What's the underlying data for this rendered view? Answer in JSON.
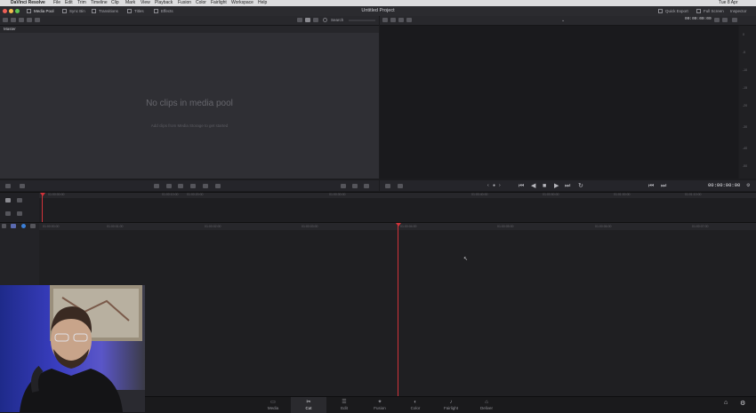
{
  "menubar": {
    "app": "DaVinci Resolve",
    "items": [
      "File",
      "Edit",
      "Trim",
      "Timeline",
      "Clip",
      "Mark",
      "View",
      "Playback",
      "Fusion",
      "Color",
      "Fairlight",
      "Workspace",
      "Help"
    ],
    "clock": "Tue 8 Apr"
  },
  "toolbar": {
    "media_pool": "Media Pool",
    "sync_bin": "Sync Bin",
    "transitions": "Transitions",
    "titles": "Titles",
    "effects": "Effects",
    "project_title": "Untitled Project",
    "quick_export": "Quick Export",
    "full_screen": "Full Screen",
    "inspector": "Inspector"
  },
  "media_pool": {
    "search_label": "Search",
    "bin_name": "Master",
    "empty_title": "No clips in media pool",
    "empty_subtitle": "Add clips from Media Storage to get started"
  },
  "viewer": {
    "timecode_top": "00:00:00:00",
    "timecode": "00:00:00:00",
    "meter_ticks": [
      "0",
      "-5",
      "-10",
      "-15",
      "-20",
      "-30",
      "-40",
      "-50"
    ]
  },
  "upper_timeline": {
    "ruler": [
      "01:00:00:00",
      "01:00:10:00",
      "01:00:20:00",
      "01:00:30:00",
      "01:00:40:00",
      "01:00:50:00",
      "01:01:00:00",
      "01:01:10:00"
    ]
  },
  "lower_timeline": {
    "ruler": [
      "01:00:00:00",
      "01:00:01:00",
      "01:00:02:00",
      "01:00:03:00",
      "01:00:04:00",
      "01:00:05:00",
      "01:00:06:00",
      "01:00:07:00"
    ]
  },
  "pages": [
    {
      "label": "Media",
      "icon": "media-page-icon"
    },
    {
      "label": "Cut",
      "icon": "cut-page-icon"
    },
    {
      "label": "Edit",
      "icon": "edit-page-icon"
    },
    {
      "label": "Fusion",
      "icon": "fusion-page-icon"
    },
    {
      "label": "Color",
      "icon": "color-page-icon"
    },
    {
      "label": "Fairlight",
      "icon": "fairlight-page-icon"
    },
    {
      "label": "Deliver",
      "icon": "deliver-page-icon"
    }
  ],
  "colors": {
    "playhead": "#d0333a",
    "panel": "#2f2f34",
    "viewer": "#1a1a1d"
  }
}
